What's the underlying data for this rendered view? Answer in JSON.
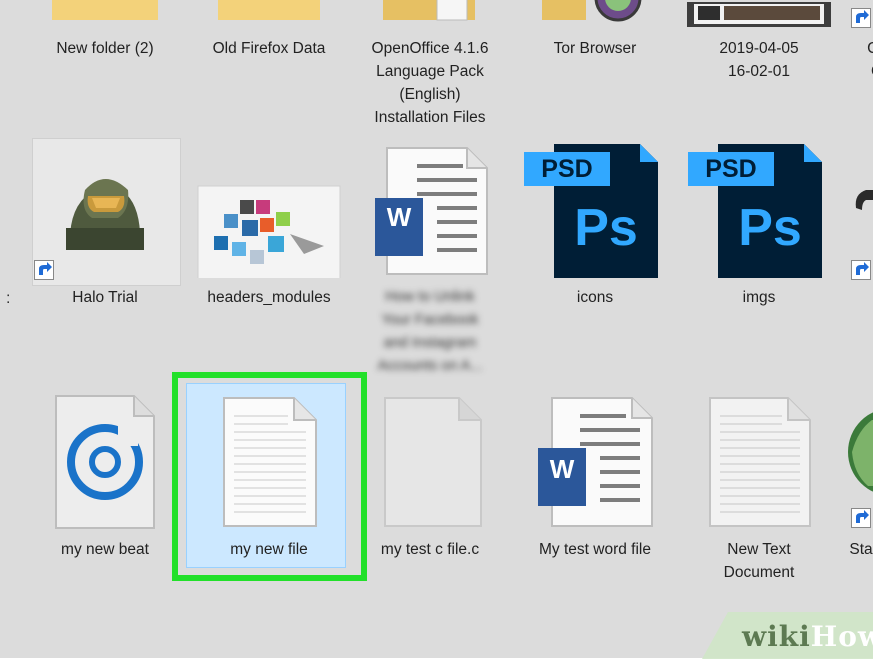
{
  "row1": [
    {
      "label": [
        "New folder (2)"
      ]
    },
    {
      "label": [
        "Old Firefox Data"
      ]
    },
    {
      "label": [
        "OpenOffice 4.1.6",
        "Language Pack",
        "(English)",
        "Installation Files"
      ]
    },
    {
      "label": [
        "Tor Browser"
      ]
    },
    {
      "label": [
        "2019-04-05",
        "16-02-01"
      ]
    },
    {
      "label": [
        "Co",
        "G"
      ]
    }
  ],
  "row2": [
    {
      "label": [
        "Halo Trial"
      ],
      "icon": "halo-helmet-icon"
    },
    {
      "label": [
        "headers_modules"
      ],
      "icon": "image-thumbnail-icon"
    },
    {
      "label": [
        "How to Unlink",
        "Your Facebook",
        "and Instagram",
        "Accounts on A..."
      ],
      "icon": "word-document-icon"
    },
    {
      "label": [
        "icons"
      ],
      "icon": "photoshop-psd-icon",
      "badge": "PSD",
      "mark": "Ps"
    },
    {
      "label": [
        "imgs"
      ],
      "icon": "photoshop-psd-icon",
      "badge": "PSD",
      "mark": "Ps"
    }
  ],
  "row3": [
    {
      "label": [
        "my new beat"
      ],
      "icon": "groove-music-icon"
    },
    {
      "label": [
        "my new file"
      ],
      "icon": "text-file-icon",
      "selected": true
    },
    {
      "label": [
        "my test c file.c"
      ],
      "icon": "blank-file-icon"
    },
    {
      "label": [
        "My test word file"
      ],
      "icon": "word-document-icon",
      "mark": "W"
    },
    {
      "label": [
        "New Text",
        "Document"
      ],
      "icon": "text-file-icon"
    },
    {
      "label": [
        "Sta"
      ],
      "icon": "globe-icon"
    }
  ],
  "word_mark": "W",
  "watermark": {
    "part1": "wiki",
    "part2": "How"
  },
  "colors": {
    "highlight": "#22e02a",
    "selection": "#cce8ff",
    "psd_blue": "#31a8ff",
    "psd_bg": "#001e36",
    "word_blue": "#2b579a"
  }
}
